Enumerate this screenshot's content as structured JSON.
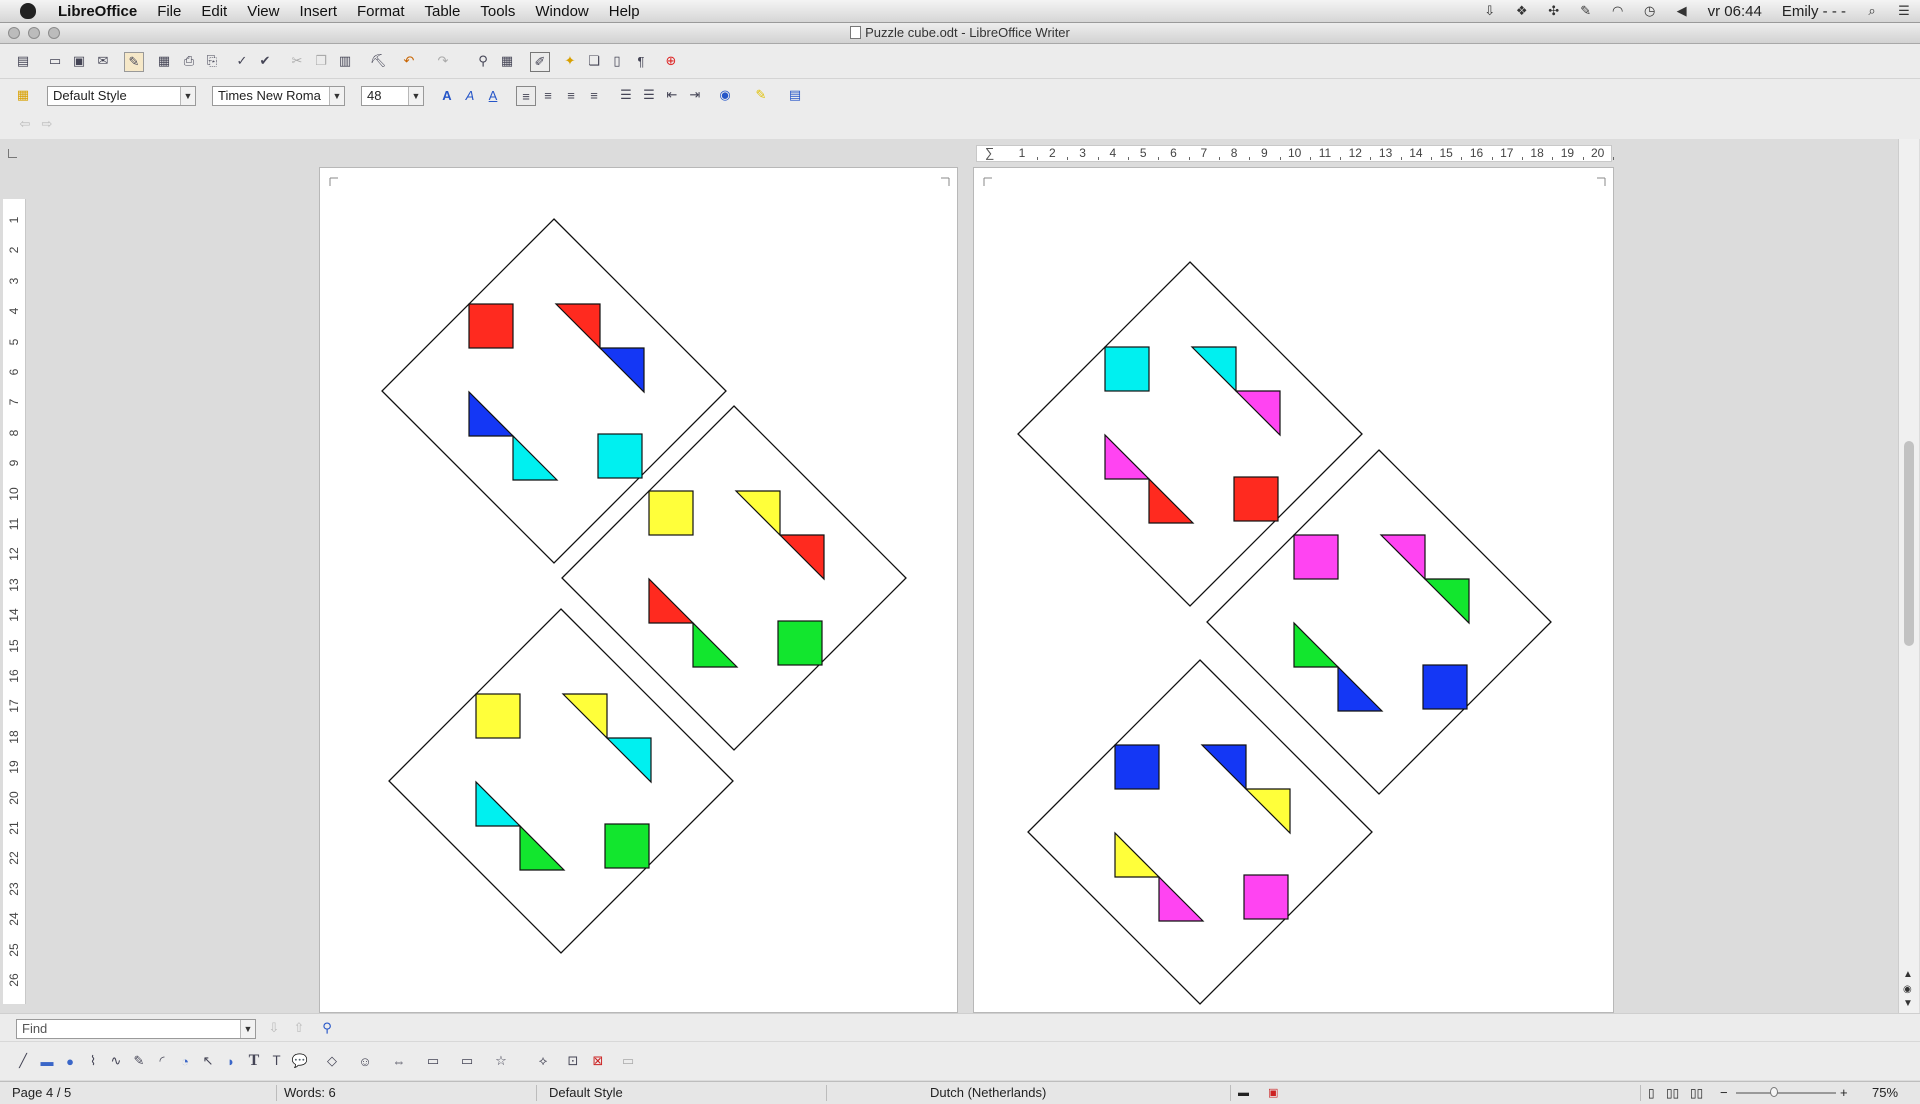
{
  "menubar": {
    "app_name": "LibreOffice",
    "menus": [
      "File",
      "Edit",
      "View",
      "Insert",
      "Format",
      "Table",
      "Tools",
      "Window",
      "Help"
    ],
    "clock": "vr 06:44",
    "user": "Emily - - -"
  },
  "window": {
    "title": "Puzzle cube.odt - LibreOffice Writer"
  },
  "formatting": {
    "paragraph_style": "Default Style",
    "font_name": "Times New Roma",
    "font_size": "48"
  },
  "ruler": {
    "h_ticks": [
      "1",
      "2",
      "3",
      "4",
      "5",
      "6",
      "7",
      "8",
      "9",
      "10",
      "11",
      "12",
      "13",
      "14",
      "15",
      "16",
      "17",
      "18",
      "19",
      "20"
    ],
    "v_ticks": [
      "1",
      "2",
      "3",
      "4",
      "5",
      "6",
      "7",
      "8",
      "9",
      "10",
      "11",
      "12",
      "13",
      "14",
      "15",
      "16",
      "17",
      "18",
      "19",
      "20",
      "21",
      "22",
      "23",
      "24",
      "25",
      "26"
    ]
  },
  "find": {
    "placeholder": "Find"
  },
  "status": {
    "page": "Page 4 / 5",
    "words": "Words: 6",
    "style": "Default Style",
    "language": "Dutch (Netherlands)",
    "zoom": "75%"
  },
  "colors": {
    "red": "#ff2a1f",
    "blue": "#1437f5",
    "cyan": "#00f0f0",
    "yellow": "#ffff3a",
    "green": "#12e62e",
    "magenta": "#ff44f2"
  },
  "pages": [
    {
      "tiles": [
        {
          "square_top": "red",
          "tri_top_a": "red",
          "tri_top_b": "blue",
          "tri_bot_a": "blue",
          "tri_bot_b": "cyan",
          "square_bot": "cyan"
        },
        {
          "square_top": "yellow",
          "tri_top_a": "yellow",
          "tri_top_b": "red",
          "tri_bot_a": "red",
          "tri_bot_b": "green",
          "square_bot": "green"
        },
        {
          "square_top": "yellow",
          "tri_top_a": "yellow",
          "tri_top_b": "cyan",
          "tri_bot_a": "cyan",
          "tri_bot_b": "green",
          "square_bot": "green"
        }
      ]
    },
    {
      "tiles": [
        {
          "square_top": "cyan",
          "tri_top_a": "cyan",
          "tri_top_b": "magenta",
          "tri_bot_a": "magenta",
          "tri_bot_b": "red",
          "square_bot": "red"
        },
        {
          "square_top": "magenta",
          "tri_top_a": "magenta",
          "tri_top_b": "green",
          "tri_bot_a": "green",
          "tri_bot_b": "blue",
          "square_bot": "blue"
        },
        {
          "square_top": "blue",
          "tri_top_a": "blue",
          "tri_top_b": "yellow",
          "tri_bot_a": "yellow",
          "tri_bot_b": "magenta",
          "square_bot": "magenta"
        }
      ]
    }
  ]
}
